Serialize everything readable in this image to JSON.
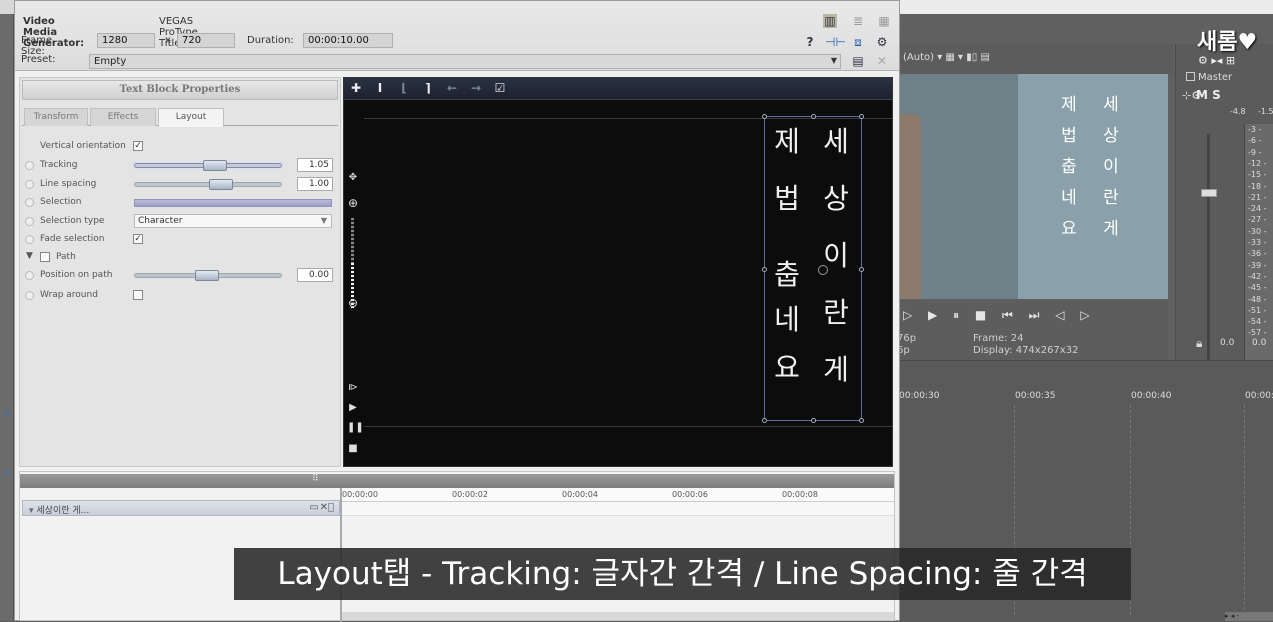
{
  "app": {
    "window_title_label": "Video Media Generator:",
    "window_title_value": "VEGAS ProType Titler",
    "frame_size_label": "Frame Size:",
    "frame_width": "1280",
    "frame_x": "x",
    "frame_height": "720",
    "duration_label": "Duration:",
    "duration_value": "00:00:10.00",
    "preset_label": "Preset:",
    "preset_value": "Empty"
  },
  "properties": {
    "title": "Text Block Properties",
    "tabs": [
      "Transform",
      "Effects",
      "Layout"
    ],
    "active_tab": "Layout",
    "rows": {
      "vertical_orientation": "Vertical orientation",
      "tracking": "Tracking",
      "tracking_value": "1.05",
      "line_spacing": "Line spacing",
      "line_spacing_value": "1.00",
      "selection": "Selection",
      "selection_type": "Selection type",
      "selection_type_value": "Character",
      "fade_selection": "Fade selection",
      "path": "Path",
      "position_on_path": "Position on path",
      "position_on_path_value": "0.00",
      "wrap_around": "Wrap around"
    }
  },
  "canvas": {
    "column_right": [
      "세",
      "상",
      "이",
      "란",
      "게"
    ],
    "column_left": [
      "제",
      "법",
      "춥",
      "네",
      "요"
    ]
  },
  "timeline": {
    "track_name": "세상이란 게...",
    "ruler": [
      "00:00:00",
      "00:00:02",
      "00:00:04",
      "00:00:06",
      "00:00:08"
    ]
  },
  "background": {
    "preview_quality": "(Auto)",
    "master_label": "Master",
    "master_ms": "M S",
    "meter_ticks": [
      "3",
      "6",
      "9",
      "12",
      "15",
      "18",
      "21",
      "24",
      "27",
      "30",
      "33",
      "36",
      "39",
      "42",
      "45",
      "48",
      "51",
      "54",
      "57"
    ],
    "meter_top_left": "-4.8",
    "meter_top_right": "-1.5",
    "meter_bottom_left": "0.0",
    "meter_bottom_right": "0.0",
    "frame_label": "Frame:",
    "frame_value": "24",
    "display_label": "Display:",
    "display_value": "474x267x32",
    "res_line1": "76p",
    "res_line2": "6p",
    "timeline_labels": [
      "00:00:30",
      "00:00:35",
      "00:00:40",
      "00:00:"
    ],
    "preview_col_right": [
      "세",
      "상",
      "이",
      "란",
      "게"
    ],
    "preview_col_left": [
      "제",
      "법",
      "춥",
      "네",
      "요"
    ]
  },
  "watermark": "새롬♥",
  "subtitle": "Layout탭 - Tracking: 글자간 간격 / Line Spacing: 줄 간격",
  "colors": {
    "canvas_bg": "#0c0c0c",
    "text_box_border": "#5b6f9e",
    "subtitle_bg": "#282828"
  }
}
